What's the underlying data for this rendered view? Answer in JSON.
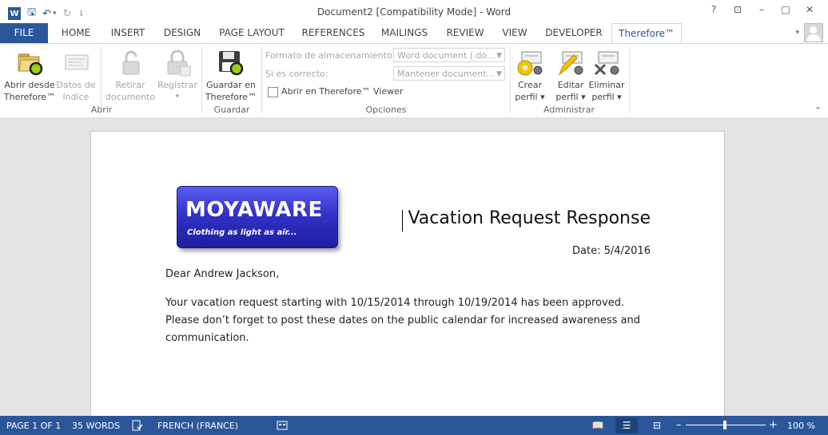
{
  "titlebar": {
    "title": "Document2 [Compatibility Mode] - Word",
    "help": "?",
    "restore_ribbon": "⊡",
    "minimize": "–",
    "maximize": "□",
    "close": "✕"
  },
  "qat": {
    "word": "W",
    "save": "🖫",
    "undo": "↶",
    "undo_drop": "▾",
    "redo": "↻",
    "customize": "⇂"
  },
  "tabs": [
    "FILE",
    "HOME",
    "INSERT",
    "DESIGN",
    "PAGE LAYOUT",
    "REFERENCES",
    "MAILINGS",
    "REVIEW",
    "VIEW",
    "DEVELOPER",
    "Therefore™"
  ],
  "user_dropdown": "▾",
  "ribbon": {
    "abrir": {
      "label": "Abrir",
      "abrir_desde": [
        "Abrir desde",
        "Therefore™"
      ],
      "datos_indice": [
        "Datos de",
        "índice"
      ]
    },
    "retirar": [
      "Retirar",
      "documento"
    ],
    "registrar": [
      "Registrar",
      "▾"
    ],
    "guardar": {
      "label": "Guardar",
      "btn": [
        "Guardar en",
        "Therefore™"
      ]
    },
    "opciones": {
      "label": "Opciones",
      "formato_label": "Formato de almacenamiento:",
      "formato_value": "Word document (.do...",
      "si_correcto_label": "Si es correcto:",
      "si_correcto_value": "Mantener document...",
      "viewer_label": "Abrir en Therefore™ Viewer"
    },
    "administrar": {
      "label": "Administrar",
      "crear": [
        "Crear",
        "perfil ▾"
      ],
      "editar": [
        "Editar",
        "perfil ▾"
      ],
      "eliminar": [
        "Eliminar",
        "perfil ▾"
      ]
    },
    "collapse": "⌃"
  },
  "document": {
    "logo_name": "MOYAWARE",
    "logo_tagline": "Clothing as light as air...",
    "title": "Vacation Request Response",
    "date": "Date: 5/4/2016",
    "greeting": "Dear Andrew Jackson,",
    "body_line1": "Your vacation request starting with 10/15/2014 through 10/19/2014 has been approved.",
    "body_line2": "Please don’t forget to post these dates on the public calendar for increased awareness and",
    "body_line3": "communication."
  },
  "status": {
    "page": "PAGE 1 OF 1",
    "words": "35 WORDS",
    "language": "FRENCH (FRANCE)",
    "zoom": "100 %",
    "zoom_minus": "–",
    "zoom_plus": "+",
    "zoom_fraction": 0.5
  },
  "colors": {
    "accent": "#2b579a"
  }
}
